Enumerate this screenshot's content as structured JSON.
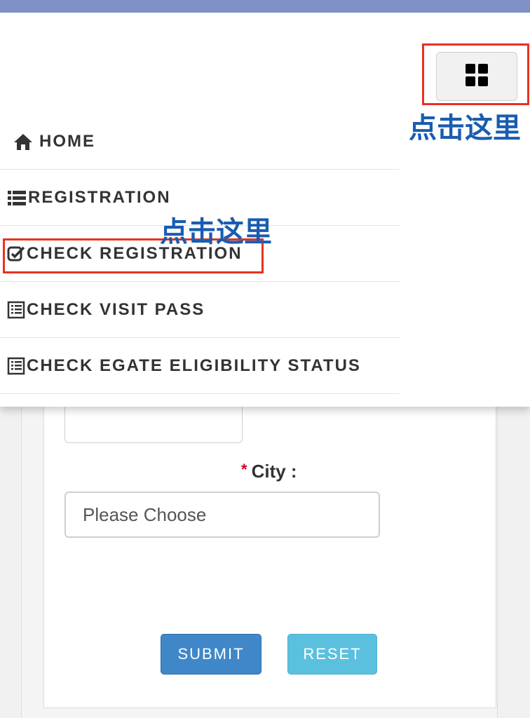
{
  "form": {
    "city_required_marker": "*",
    "city_label": "City :",
    "city_placeholder": "Please Choose",
    "submit_label": "SUBMIT",
    "reset_label": "RESET"
  },
  "nav": {
    "items": [
      {
        "label": "HOME",
        "icon": "home-icon"
      },
      {
        "label": "REGISTRATION",
        "icon": "list-icon"
      },
      {
        "label": "CHECK REGISTRATION",
        "icon": "check-square-icon"
      },
      {
        "label": "CHECK VISIT PASS",
        "icon": "document-list-icon"
      },
      {
        "label": "CHECK EGATE ELIGIBILITY STATUS",
        "icon": "document-list-icon"
      }
    ]
  },
  "annotations": {
    "toggle_hint": "点击这里",
    "check_registration_hint": "点击这里"
  },
  "colors": {
    "topbar": "#8091c8",
    "highlight": "#e53322",
    "annotation_text": "#1a5cb0",
    "submit": "#3f87c8",
    "reset": "#5bc0de"
  }
}
